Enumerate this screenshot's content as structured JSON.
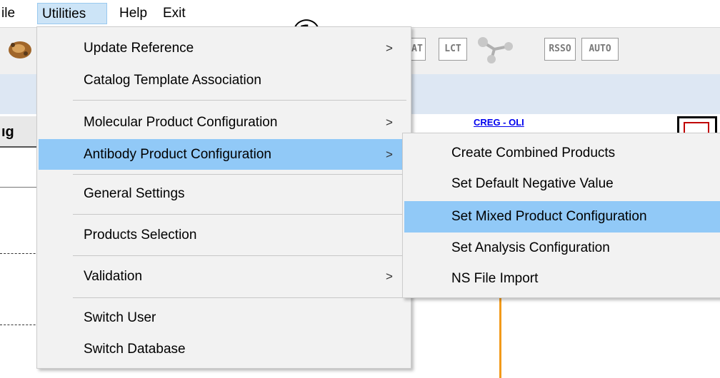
{
  "menubar": {
    "items": [
      {
        "label": "ile"
      },
      {
        "label": "Utilities"
      },
      {
        "label": "Help"
      },
      {
        "label": "Exit"
      }
    ]
  },
  "toolbar": {
    "buttons": [
      "AT",
      "LCT",
      "RSSO",
      "AUTO"
    ]
  },
  "annotation": {
    "step_marker": "①"
  },
  "background": {
    "column_header_fragment": "ıg",
    "link_text": "CREG - OLI"
  },
  "utilities_menu": {
    "items": [
      {
        "label": "Update Reference",
        "submenu": true
      },
      {
        "label": "Catalog Template Association",
        "submenu": false
      },
      {
        "label": "Molecular Product Configuration",
        "submenu": true
      },
      {
        "label": "Antibody Product Configuration",
        "submenu": true,
        "highlighted": true
      },
      {
        "label": "General Settings",
        "submenu": false
      },
      {
        "label": "Products Selection",
        "submenu": false
      },
      {
        "label": "Validation",
        "submenu": true
      },
      {
        "label": "Switch User",
        "submenu": false
      },
      {
        "label": "Switch Database",
        "submenu": false
      }
    ],
    "arrow_glyph": ">"
  },
  "antibody_submenu": {
    "items": [
      {
        "label": "Create Combined Products"
      },
      {
        "label": "Set Default Negative Value"
      },
      {
        "label": "Set Mixed Product Configuration",
        "highlighted": true
      },
      {
        "label": "Set Analysis Configuration"
      },
      {
        "label": "NS File Import"
      }
    ]
  },
  "colors": {
    "menu_highlight": "#91c9f7",
    "menubar_active": "#cce4f7",
    "marker_line": "#f29a1a"
  }
}
